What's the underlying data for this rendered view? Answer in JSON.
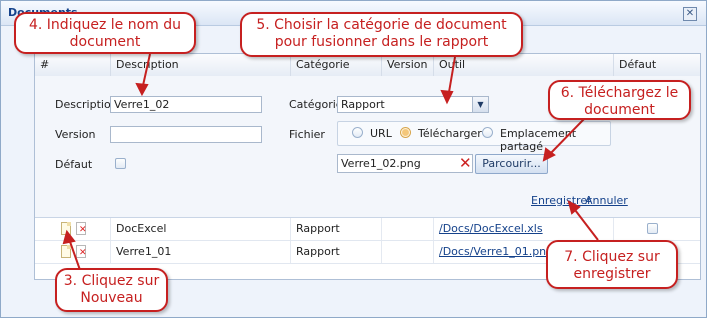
{
  "dialog": {
    "title": "Documents",
    "close_glyph": "✕"
  },
  "grid": {
    "headers": [
      "#",
      "Description",
      "Catégorie",
      "Version",
      "Outil",
      "Défaut"
    ]
  },
  "form": {
    "description_label": "Description",
    "description_value": "Verre1_02",
    "version_label": "Version",
    "version_value": "",
    "default_label": "Défaut",
    "category_label": "Catégorie",
    "category_value": "Rapport",
    "file_label": "Fichier",
    "radio_url": "URL",
    "radio_upload": "Télécharger",
    "radio_shared": "Emplacement partagé",
    "filename_value": "Verre1_02.png",
    "browse_label": "Parcourir...",
    "save_link": "Enregistrer",
    "cancel_link": "Annuler"
  },
  "rows": [
    {
      "description": "DocExcel",
      "category": "Rapport",
      "version": "",
      "link": "/Docs/DocExcel.xls"
    },
    {
      "description": "Verre1_01",
      "category": "Rapport",
      "version": "",
      "link": "/Docs/Verre1_01.png"
    }
  ],
  "callouts": {
    "c3": "3. Cliquez sur Nouveau",
    "c4": "4. Indiquez le nom du document",
    "c5": "5. Choisir la catégorie de document pour fusionner dans le rapport",
    "c6": "6. Téléchargez le document",
    "c7": "7. Cliquez sur enregistrer"
  },
  "colors": {
    "callout": "#c62020",
    "link": "#15428b",
    "title": "#15428b"
  }
}
